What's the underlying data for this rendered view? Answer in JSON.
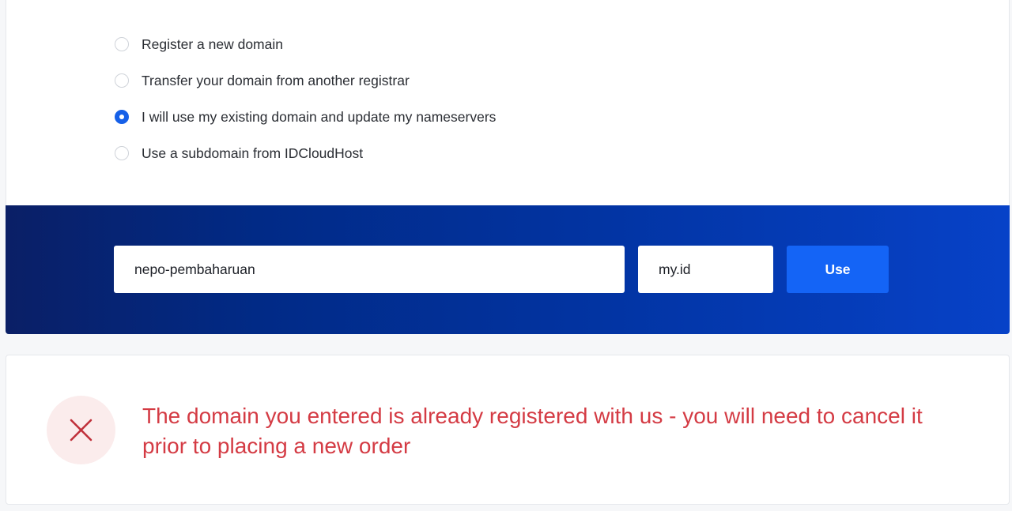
{
  "domain_options": [
    {
      "label": "Register a new domain",
      "checked": false
    },
    {
      "label": "Transfer your domain from another registrar",
      "checked": false
    },
    {
      "label": "I will use my existing domain and update my nameservers",
      "checked": true
    },
    {
      "label": "Use a subdomain from IDCloudHost",
      "checked": false
    }
  ],
  "domain_form": {
    "sld_value": "nepo-pembaharuan",
    "tld_value": "my.id",
    "submit_label": "Use"
  },
  "error": {
    "icon": "close-icon",
    "message": "The domain you entered is already registered with us - you will need to cancel it prior to placing a new order"
  },
  "colors": {
    "accent": "#1464f6",
    "error": "#d43b44",
    "banner_start": "#0a1f66",
    "banner_end": "#0742c8"
  }
}
